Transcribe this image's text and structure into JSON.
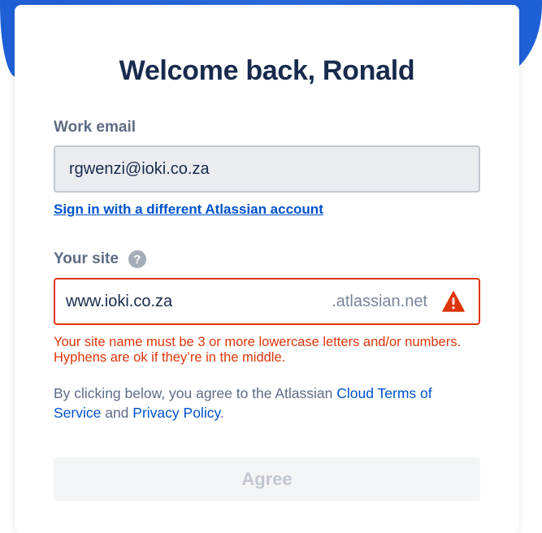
{
  "page": {
    "title": "Welcome back, Ronald"
  },
  "email": {
    "label": "Work email",
    "value": "rgwenzi@ioki.co.za",
    "switch_account_link": "Sign in with a different Atlassian account"
  },
  "site": {
    "label": "Your site",
    "help_icon": "question-circle-icon",
    "value": "www.ioki.co.za",
    "suffix": ".atlassian.net",
    "warning_icon": "warning-triangle-icon",
    "error": "Your site name must be 3 or more lowercase letters and/or numbers. Hyphens are ok if they’re in the middle."
  },
  "terms": {
    "prefix": "By clicking below, you agree to the Atlassian ",
    "cloud_terms_link": "Cloud Terms of Service",
    "and": " and ",
    "privacy_link": "Privacy Policy",
    "suffix": "."
  },
  "actions": {
    "agree_label": "Agree"
  },
  "colors": {
    "brand_blue": "#0052cc",
    "header_blue": "#1f5fd6",
    "error_red": "#de350b",
    "title_navy": "#172b4d"
  }
}
